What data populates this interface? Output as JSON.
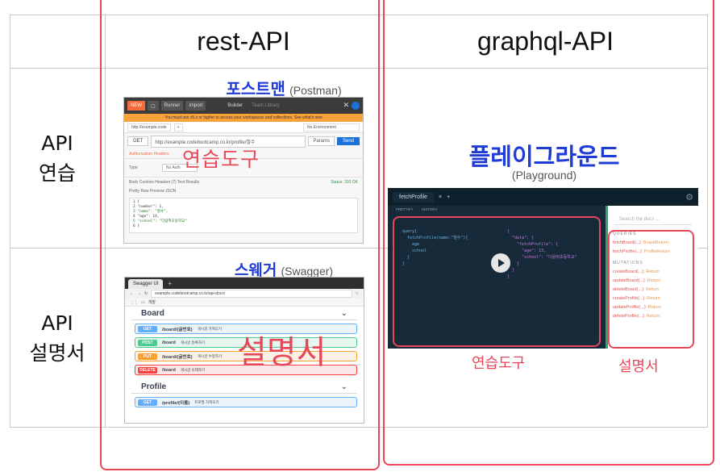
{
  "columns": {
    "rest": "rest-API",
    "graphql": "graphql-API"
  },
  "rows": {
    "practice": [
      "API",
      "연습"
    ],
    "docs": [
      "API",
      "설명서"
    ]
  },
  "postman": {
    "title_ko": "포스트맨",
    "title_en": "(Postman)",
    "overlay": "연습도구",
    "buttons": [
      "NEW",
      "Runner",
      "Import",
      "Builder",
      "Team Library"
    ],
    "banner": "You must use v5.x or higher to access your workspaces and collections. See what's new",
    "tab": "http://example.code",
    "env": "No Environment",
    "method": "GET",
    "url": "http://example.codebootcamp.co.kr/profile/철수",
    "params": "Params",
    "send": "Send",
    "auth_tabs": "Authorization   Headers",
    "type_label": "Type",
    "type_value": "No Auth",
    "body_tabs": "Body   Cookies   Headers (7)   Test Results",
    "status": "Status: 200 OK",
    "view_tabs": "Pretty   Raw   Preview   JSON",
    "code_lines": [
      "1 {",
      "2   \"number\": 1,",
      "3   \"name\": \"철수\",",
      "4   \"age\": 14,",
      "5   \"school\": \"다람쥐초등학교\"",
      "6 }"
    ]
  },
  "swagger": {
    "title_ko": "스웨거",
    "title_en": "(Swagger)",
    "overlay": "설명서",
    "tab": "Swagger UI",
    "address": "example.codebootcamp.co.kr/api-docs/",
    "bookmark": "개발",
    "section1": "Board",
    "section2": "Profile",
    "ops": [
      {
        "method": "GET",
        "path": "/board/{글번호}",
        "desc": "게시글 가져오기",
        "kind": "get"
      },
      {
        "method": "POST",
        "path": "/board",
        "desc": "게시글 등록하기",
        "kind": "post"
      },
      {
        "method": "PUT",
        "path": "/board/{글번호}",
        "desc": "게시글 수정하기",
        "kind": "put"
      },
      {
        "method": "DELETE",
        "path": "/board",
        "desc": "게시글 삭제하기",
        "kind": "del"
      }
    ],
    "profile_op": {
      "method": "GET",
      "path": "/profile/{이름}",
      "desc": "프로필 가져오기",
      "kind": "get"
    }
  },
  "playground": {
    "title_ko": "플레이그라운드",
    "title_en": "(Playground)",
    "tab": "fetchProfile",
    "toolbar": [
      "PRETTIFY",
      "HISTORY"
    ],
    "query": "query{\n  fetchProfile(name:\"철수\"){\n    age\n    school\n  }\n}",
    "result": "{\n  \"data\": {\n    \"fetchProfile\": {\n      \"age\": 13,\n      \"school\": \"다람쥐초등학교\"\n    }\n  }\n}",
    "search": "Search the docs ...",
    "queries_header": "QUERIES",
    "queries": [
      {
        "name": "fetchBoard(...)",
        "type": ": BoardReturn"
      },
      {
        "name": "fetchProfile(...)",
        "type": ": ProfileReturn"
      }
    ],
    "mutations_header": "MUTATIONS",
    "mutations": [
      {
        "name": "createBoard(...)",
        "type": ": Return"
      },
      {
        "name": "updateBoard(...)",
        "type": ": Return"
      },
      {
        "name": "deleteBoard(...)",
        "type": ": Return"
      },
      {
        "name": "createProfile(...)",
        "type": ": Return"
      },
      {
        "name": "updateProfile(...)",
        "type": ": Return"
      },
      {
        "name": "deleteProfile(...)",
        "type": ": Return"
      }
    ],
    "label_practice": "연습도구",
    "label_docs": "설명서"
  },
  "colors": {
    "accent_red": "#e8475a",
    "title_blue": "#1f3bd6"
  }
}
